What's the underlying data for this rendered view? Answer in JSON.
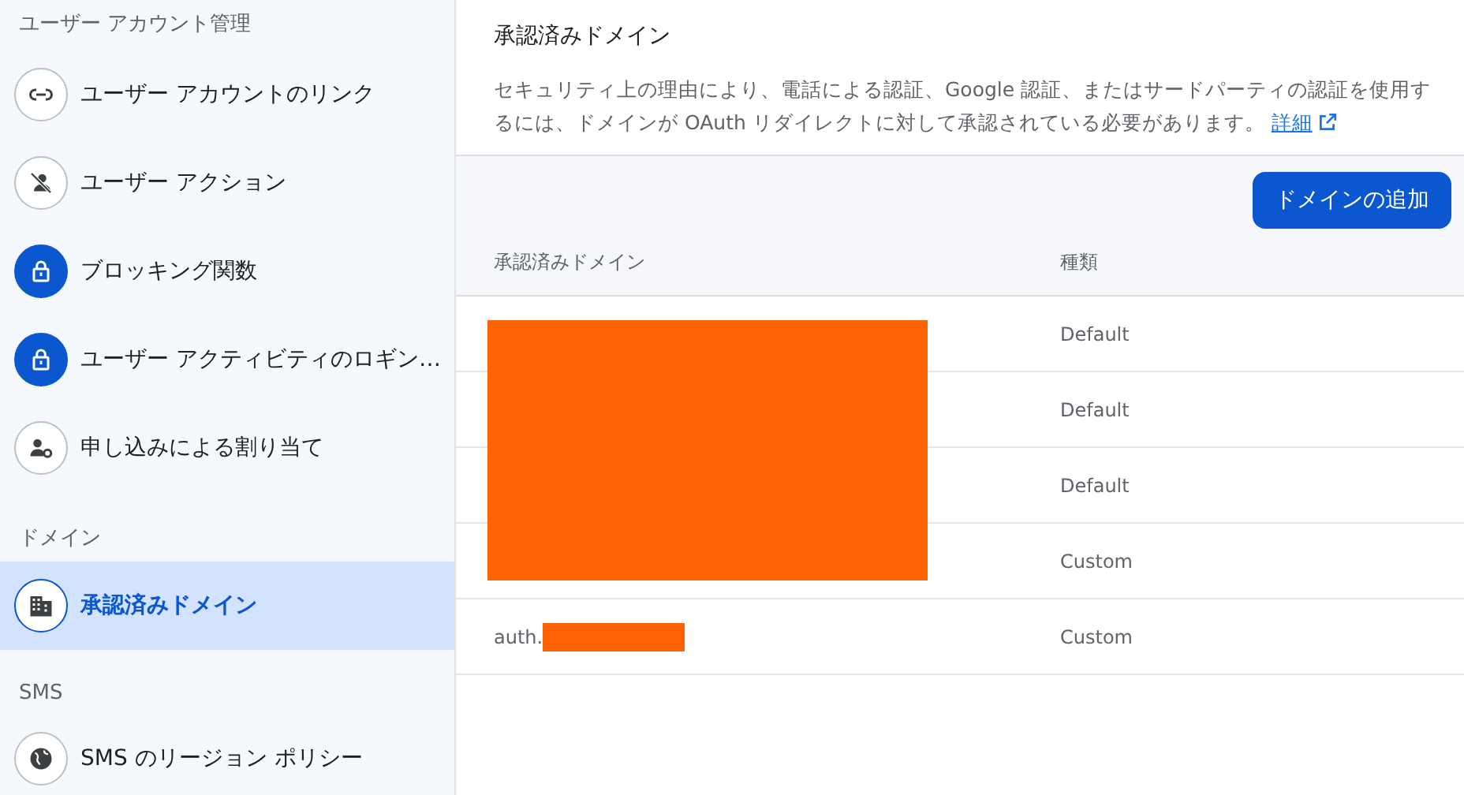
{
  "sidebar": {
    "sections": [
      {
        "heading": "ユーザー アカウント管理",
        "items": [
          {
            "label": "ユーザー アカウントのリンク",
            "kind": "link",
            "selected": false
          },
          {
            "label": "ユーザー アクション",
            "kind": "user-off",
            "selected": false
          },
          {
            "label": "ブロッキング関数",
            "kind": "lock",
            "selected": false
          },
          {
            "label": "ユーザー アクティビティのロギン…",
            "kind": "lock",
            "selected": false
          },
          {
            "label": "申し込みによる割り当て",
            "kind": "user-gear",
            "selected": false
          }
        ]
      },
      {
        "heading": "ドメイン",
        "items": [
          {
            "label": "承認済みドメイン",
            "kind": "building",
            "selected": true
          }
        ]
      },
      {
        "heading": "SMS",
        "items": [
          {
            "label": "SMS のリージョン ポリシー",
            "kind": "globe",
            "selected": false
          }
        ]
      }
    ]
  },
  "main": {
    "title": "承認済みドメイン",
    "description": "セキュリティ上の理由により、電話による認証、Google 認証、またはサードパーティの認証を使用するには、ドメインが OAuth リダイレクトに対して承認されている必要があります。",
    "link": "詳細",
    "add_button": "ドメインの追加",
    "table": {
      "columns": [
        "承認済みドメイン",
        "種類"
      ],
      "rows": [
        {
          "type": "Default",
          "redacted": true
        },
        {
          "type": "Default",
          "redacted": true
        },
        {
          "type": "Default",
          "redacted": true
        },
        {
          "type": "Custom",
          "redacted": true
        },
        {
          "domain": "auth.",
          "type": "Custom",
          "redacted": true
        }
      ]
    }
  }
}
